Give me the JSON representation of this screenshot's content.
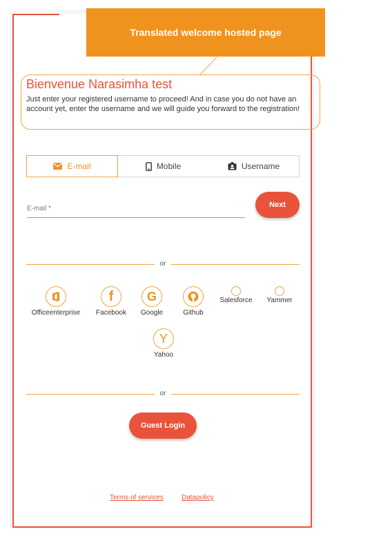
{
  "callout": {
    "text": "Translated welcome hosted page"
  },
  "welcome": {
    "title": "Bienvenue Narasimha test",
    "text": "Just enter your registered username to proceed! And in case you do not have an account yet, enter the username and we will guide you forward to the registration!"
  },
  "tabs": [
    {
      "label": "E-mail",
      "icon": "envelope-icon",
      "active": true
    },
    {
      "label": "Mobile",
      "icon": "mobile-icon",
      "active": false
    },
    {
      "label": "Username",
      "icon": "id-badge-icon",
      "active": false
    }
  ],
  "email_field": {
    "label": "E-mail *",
    "value": ""
  },
  "next_label": "Next",
  "separator_text": "or",
  "social": [
    {
      "name": "Officeenterprise",
      "icon": "office-icon"
    },
    {
      "name": "Facebook",
      "icon": "facebook-icon"
    },
    {
      "name": "Google",
      "icon": "google-icon"
    },
    {
      "name": "Github",
      "icon": "github-icon"
    },
    {
      "name": "Salesforce",
      "icon": "circle-icon"
    },
    {
      "name": "Yammer",
      "icon": "circle-icon"
    },
    {
      "name": "Yahoo",
      "icon": "yahoo-icon"
    }
  ],
  "guest_login_label": "Guest Login",
  "footer": {
    "terms": "Terms of services",
    "datapolicy": "Datapolicy"
  },
  "colors": {
    "accent": "#e9533a",
    "orange": "#f0931e",
    "outline": "#f0a348"
  }
}
